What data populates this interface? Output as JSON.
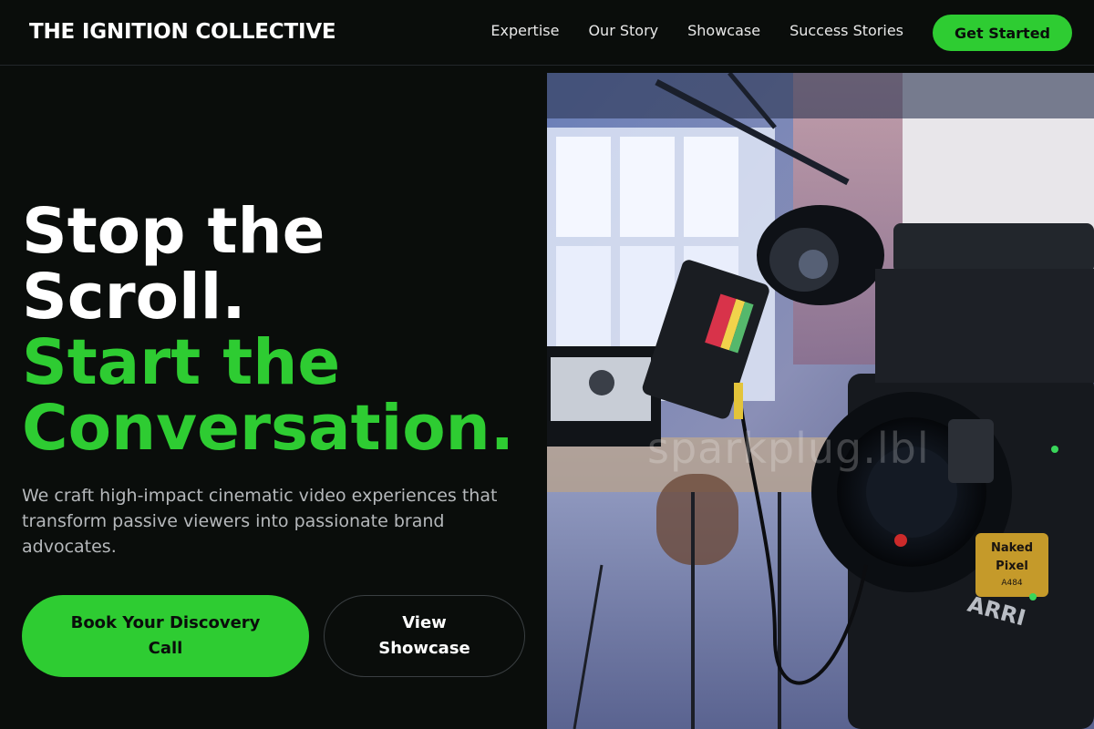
{
  "header": {
    "brand": "THE IGNITION COLLECTIVE",
    "nav": [
      {
        "label": "Expertise"
      },
      {
        "label": "Our Story"
      },
      {
        "label": "Showcase"
      },
      {
        "label": "Success Stories"
      }
    ],
    "cta_label": "Get Started"
  },
  "hero": {
    "headline_white_1": "Stop the",
    "headline_white_2": "Scroll.",
    "headline_green_1": "Start the",
    "headline_green_2": "Conversation.",
    "subtext": "We craft high-impact cinematic video experiences that transform passive viewers into passionate brand advocates.",
    "primary_button": "Book Your Discovery Call",
    "secondary_button": "View Showcase"
  },
  "image": {
    "watermark": "sparkplug.lbl",
    "camera_brand": "ARRI",
    "camera_badge_line1": "Naked",
    "camera_badge_line2": "Pixel",
    "camera_badge_line3": "A484"
  },
  "colors": {
    "background": "#0a0d0b",
    "accent": "#2ecc32",
    "text_primary": "#ffffff",
    "text_muted": "#b5b8bb"
  }
}
